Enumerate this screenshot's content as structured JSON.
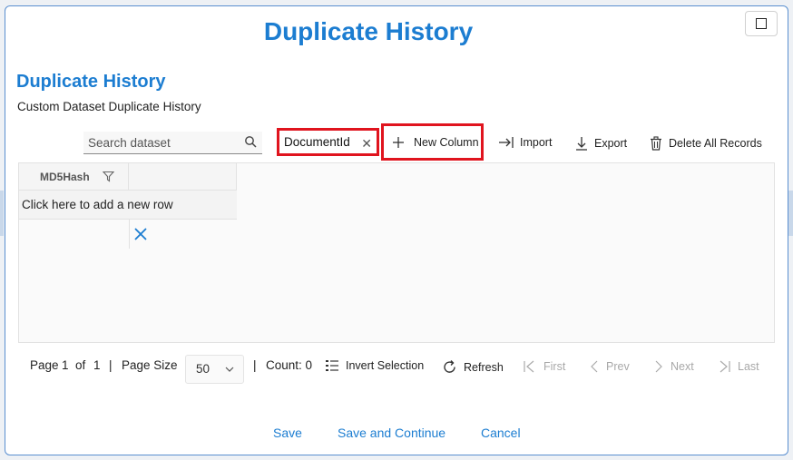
{
  "dialog": {
    "title": "Duplicate History",
    "maximize_icon": "maximize-icon"
  },
  "section": {
    "title": "Duplicate History",
    "subtitle": "Custom Dataset Duplicate History"
  },
  "toolbar": {
    "search_placeholder": "Search dataset",
    "column_name_value": "DocumentId",
    "new_column_label": "New Column",
    "import_label": "Import",
    "export_label": "Export",
    "delete_all_label": "Delete All Records"
  },
  "grid": {
    "columns": [
      "MD5Hash"
    ],
    "add_row_text": "Click here to add a new row"
  },
  "pager": {
    "page_label": "Page",
    "page": "1",
    "of_label": "of",
    "total_pages": "1",
    "sep1": "|",
    "page_size_label": "Page Size",
    "page_size": "50",
    "sep2": "|",
    "count_text": "Count: 0",
    "invert_label": "Invert Selection",
    "refresh_label": "Refresh",
    "first_label": "First",
    "prev_label": "Prev",
    "next_label": "Next",
    "last_label": "Last"
  },
  "footer": {
    "save_label": "Save",
    "save_continue_label": "Save and Continue",
    "cancel_label": "Cancel"
  },
  "colors": {
    "accent": "#1c7dd1",
    "highlight": "#e0141e"
  }
}
